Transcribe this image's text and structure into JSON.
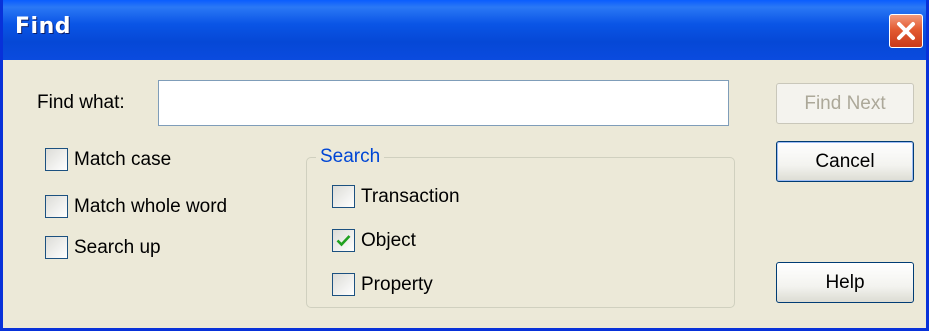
{
  "window": {
    "title": "Find",
    "close_icon": "close-icon"
  },
  "find": {
    "label": "Find what:",
    "value": "",
    "placeholder": ""
  },
  "options": {
    "match_case": {
      "label": "Match case",
      "checked": false
    },
    "match_whole_word": {
      "label": "Match whole word",
      "checked": false
    },
    "search_up": {
      "label": "Search up",
      "checked": false
    }
  },
  "search_group": {
    "title": "Search",
    "transaction": {
      "label": "Transaction",
      "checked": false
    },
    "object": {
      "label": "Object",
      "checked": true
    },
    "property": {
      "label": "Property",
      "checked": false
    }
  },
  "buttons": {
    "find_next": {
      "label": "Find Next",
      "enabled": false
    },
    "cancel": {
      "label": "Cancel"
    },
    "help": {
      "label": "Help"
    }
  },
  "colors": {
    "titlebar": "#0A55E6",
    "dialog_bg": "#ECE9D8",
    "group_title": "#0046D5",
    "check_mark": "#21A121",
    "close_button": "#E35B32"
  }
}
